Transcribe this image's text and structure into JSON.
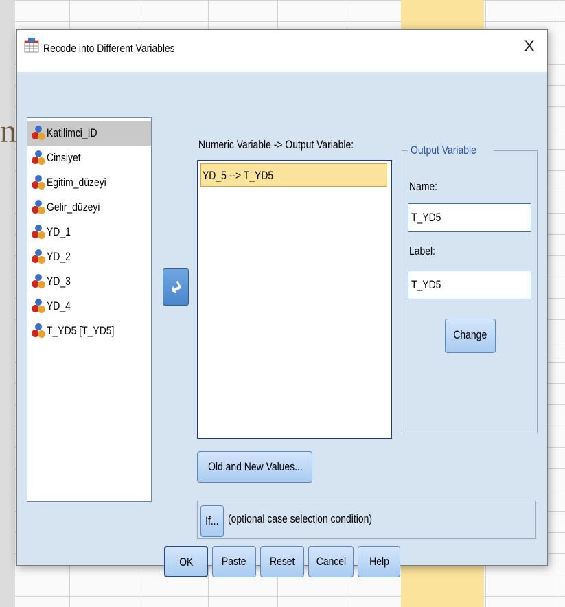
{
  "dialog": {
    "title": "Recode into Different Variables",
    "close_label": "X"
  },
  "variables": [
    {
      "label": "Katilimci_ID",
      "selected": true
    },
    {
      "label": "Cinsiyet",
      "selected": false
    },
    {
      "label": "Egitim_düzeyi",
      "selected": false
    },
    {
      "label": "Gelir_düzeyi",
      "selected": false
    },
    {
      "label": "YD_1",
      "selected": false
    },
    {
      "label": "YD_2",
      "selected": false
    },
    {
      "label": "YD_3",
      "selected": false
    },
    {
      "label": "YD_4",
      "selected": false
    },
    {
      "label": "T_YD5 [T_YD5]",
      "selected": false
    }
  ],
  "numeric_variable": {
    "heading": "Numeric Variable -> Output Variable:",
    "items": [
      "YD_5 --> T_YD5"
    ]
  },
  "output_variable": {
    "legend": "Output Variable",
    "name_label": "Name:",
    "name_value": "T_YD5",
    "label_label": "Label:",
    "label_value": "T_YD5",
    "change_label": "Change"
  },
  "buttons": {
    "old_new_values": "Old and New Values...",
    "if_button": "If...",
    "if_text": "(optional case selection condition)",
    "ok": "OK",
    "paste": "Paste",
    "reset": "Reset",
    "cancel": "Cancel",
    "help": "Help"
  },
  "background": {
    "letter": "n"
  },
  "colors": {
    "dialog_body": "#d6e3f1",
    "selected_item": "#fbe39c",
    "button_blue": "#4a86cc"
  }
}
